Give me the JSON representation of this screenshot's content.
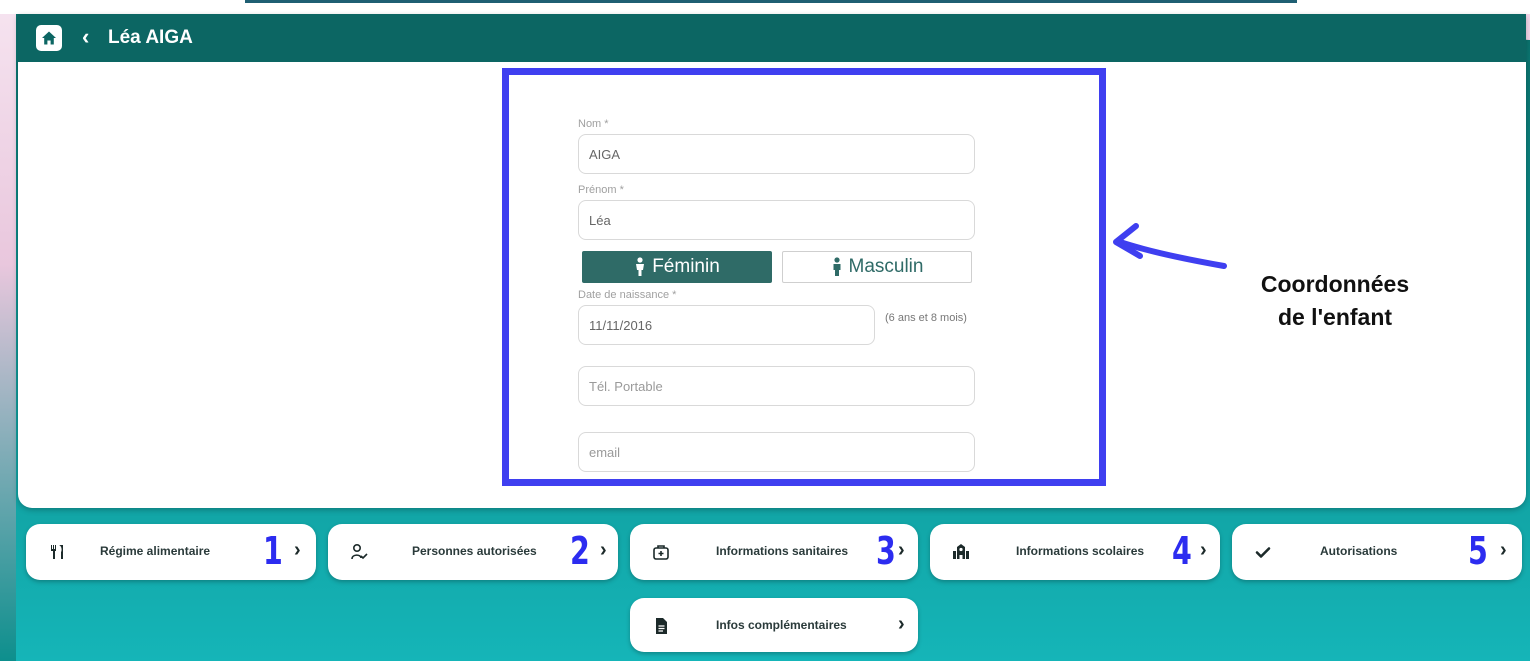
{
  "header": {
    "child_name": "Léa AIGA"
  },
  "form": {
    "nom": {
      "label": "Nom *",
      "value": "AIGA"
    },
    "prenom": {
      "label": "Prénom *",
      "value": "Léa"
    },
    "gender": {
      "female": "Féminin",
      "male": "Masculin",
      "selected": "Féminin"
    },
    "birthdate": {
      "label": "Date de naissance *",
      "value": "11/11/2016",
      "age_note": "(6 ans et 8 mois)"
    },
    "phone": {
      "placeholder": "Tél. Portable"
    },
    "email": {
      "placeholder": "email"
    }
  },
  "callout": {
    "line1": "Coordonnées",
    "line2": "de l'enfant"
  },
  "nav": [
    {
      "label": "Régime alimentaire",
      "number": "1",
      "icon": "utensils-icon"
    },
    {
      "label": "Personnes autorisées",
      "number": "2",
      "icon": "person-check-icon"
    },
    {
      "label": "Informations sanitaires",
      "number": "3",
      "icon": "medical-kit-icon"
    },
    {
      "label": "Informations scolaires",
      "number": "4",
      "icon": "school-icon"
    },
    {
      "label": "Autorisations",
      "number": "5",
      "icon": "checkmark-icon"
    },
    {
      "label": "Infos complémentaires",
      "number": "",
      "icon": "document-icon"
    }
  ],
  "colors": {
    "header": "#0c6663",
    "accent_blue": "#3f3ff0",
    "female_button": "#2f6b67"
  }
}
